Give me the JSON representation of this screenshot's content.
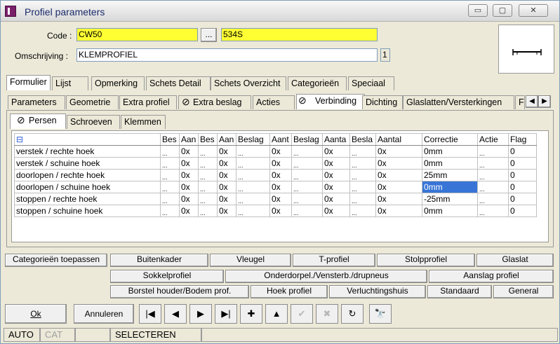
{
  "window": {
    "title": "Profiel parameters",
    "min_glyph": "▭",
    "max_glyph": "▢",
    "close_glyph": "✕"
  },
  "form": {
    "code_label": "Code :",
    "code_value": "CW50",
    "code_browse": "...",
    "code_desc": "534S",
    "omschrijving_label": "Omschrijving :",
    "omschrijving_value": "KLEMPROFIEL",
    "count_value": "1"
  },
  "main_tabs": [
    "Formulier",
    "Lijst",
    "Opmerking",
    "Schets Detail",
    "Schets Overzicht",
    "Categorieën",
    "Speciaal"
  ],
  "sub_tabs": [
    "Parameters",
    "Geometrie",
    "Extra profiel",
    "Extra beslag",
    "Acties",
    "Verbinding",
    "Dichting",
    "Glaslatten/Versterkingen",
    "F"
  ],
  "inner_tabs": [
    "Persen",
    "Schroeven",
    "Klemmen"
  ],
  "table": {
    "collapse_glyph": "⊟",
    "headers": [
      "Bes",
      "Aan",
      "Bes",
      "Aan",
      "Beslag",
      "Aant",
      "Beslag",
      "Aanta",
      "Besla",
      "Aantal",
      "Correctie",
      "Actie",
      "Flag"
    ],
    "dots": "...",
    "rows": [
      {
        "name": "verstek / rechte hoek",
        "a1": "0x",
        "a2": "0x",
        "a3": "0x",
        "a4": "0x",
        "a5": "0x",
        "correctie": "0mm",
        "flag": "0"
      },
      {
        "name": "verstek / schuine hoek",
        "a1": "0x",
        "a2": "0x",
        "a3": "0x",
        "a4": "0x",
        "a5": "0x",
        "correctie": "0mm",
        "flag": "0"
      },
      {
        "name": "doorlopen / rechte hoek",
        "a1": "0x",
        "a2": "0x",
        "a3": "0x",
        "a4": "0x",
        "a5": "0x",
        "correctie": "25mm",
        "flag": "0"
      },
      {
        "name": "doorlopen / schuine hoek",
        "a1": "0x",
        "a2": "0x",
        "a3": "0x",
        "a4": "0x",
        "a5": "0x",
        "correctie": "0mm",
        "flag": "0"
      },
      {
        "name": "stoppen / rechte hoek",
        "a1": "0x",
        "a2": "0x",
        "a3": "0x",
        "a4": "0x",
        "a5": "0x",
        "correctie": "-25mm",
        "flag": "0"
      },
      {
        "name": "stoppen / schuine hoek",
        "a1": "0x",
        "a2": "0x",
        "a3": "0x",
        "a4": "0x",
        "a5": "0x",
        "correctie": "0mm",
        "flag": "0"
      }
    ]
  },
  "category_buttons": {
    "row1": [
      "Categorieën toepassen",
      "Buitenkader",
      "Vleugel",
      "T-profiel",
      "Stolpprofiel",
      "Glaslat"
    ],
    "row2": [
      "Sokkelprofiel",
      "Onderdorpel./Vensterb./drupneus",
      "Aanslag profiel"
    ],
    "row3": [
      "Borstel houder/Bodem prof.",
      "Hoek profiel",
      "Verluchtingshuis",
      "Standaard",
      "General"
    ]
  },
  "actions": {
    "ok": "Ok",
    "annuleren": "Annuleren",
    "nav_glyphs": [
      "|◀",
      "◀",
      "▶",
      "▶|",
      "✚",
      "▲",
      "✔",
      "✖",
      "↻",
      "🔭"
    ]
  },
  "status": [
    "AUTO",
    "CAT",
    "",
    "SELECTEREN"
  ],
  "colors": {
    "yellow_field": "#ffff33",
    "selection": "#3875d7"
  }
}
